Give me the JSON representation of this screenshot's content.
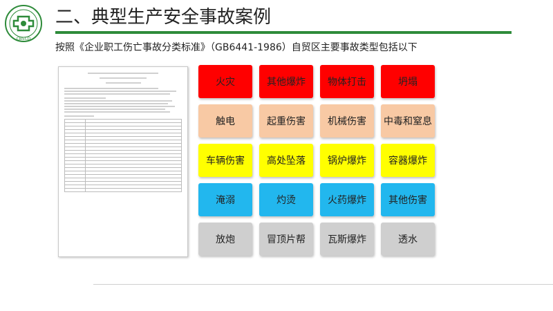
{
  "logo": {
    "text": "CBSCD",
    "color": "#2e8b3a"
  },
  "header": {
    "title": "二、典型生产安全事故案例",
    "rule_color": "#2e8b3a"
  },
  "subtitle": "按照《企业职工伤亡事故分类标准》（GB6441-1986）自贸区主要事故类型包括以下",
  "accident_types": [
    {
      "label": "火灾",
      "color": "#ff0000"
    },
    {
      "label": "其他爆炸",
      "color": "#ff0000"
    },
    {
      "label": "物体打击",
      "color": "#ff0000"
    },
    {
      "label": "坍塌",
      "color": "#ff0000"
    },
    {
      "label": "触电",
      "color": "#f8c9a4"
    },
    {
      "label": "起重伤害",
      "color": "#f8c9a4"
    },
    {
      "label": "机械伤害",
      "color": "#f8c9a4"
    },
    {
      "label": "中毒和窒息",
      "color": "#f8c9a4"
    },
    {
      "label": "车辆伤害",
      "color": "#ffff00"
    },
    {
      "label": "高处坠落",
      "color": "#ffff00"
    },
    {
      "label": "锅炉爆炸",
      "color": "#ffff00"
    },
    {
      "label": "容器爆炸",
      "color": "#ffff00"
    },
    {
      "label": "淹溺",
      "color": "#22b7ee"
    },
    {
      "label": "灼烫",
      "color": "#22b7ee"
    },
    {
      "label": "火药爆炸",
      "color": "#22b7ee"
    },
    {
      "label": "其他伤害",
      "color": "#22b7ee"
    },
    {
      "label": "放炮",
      "color": "#cfcfcf"
    },
    {
      "label": "冒顶片帮",
      "color": "#cfcfcf"
    },
    {
      "label": "瓦斯爆炸",
      "color": "#cfcfcf"
    },
    {
      "label": "透水",
      "color": "#cfcfcf"
    }
  ]
}
